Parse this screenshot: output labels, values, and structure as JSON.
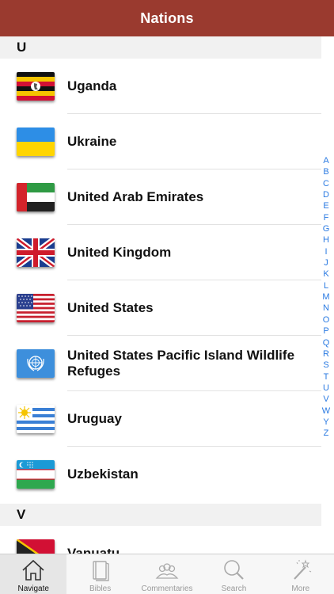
{
  "navbar": {
    "title": "Nations"
  },
  "sections": [
    {
      "letter": "U",
      "items": [
        {
          "name": "Uganda",
          "flag": "uganda-flag-icon"
        },
        {
          "name": "Ukraine",
          "flag": "ukraine-flag-icon"
        },
        {
          "name": "United Arab Emirates",
          "flag": "uae-flag-icon"
        },
        {
          "name": "United Kingdom",
          "flag": "uk-flag-icon"
        },
        {
          "name": "United States",
          "flag": "us-flag-icon"
        },
        {
          "name": "United States Pacific Island Wildlife Refuges",
          "flag": "un-flag-icon"
        },
        {
          "name": "Uruguay",
          "flag": "uruguay-flag-icon"
        },
        {
          "name": "Uzbekistan",
          "flag": "uzbekistan-flag-icon"
        }
      ]
    },
    {
      "letter": "V",
      "items": [
        {
          "name": "Vanuatu",
          "flag": "vanuatu-flag-icon"
        }
      ]
    }
  ],
  "index_letters": [
    "A",
    "B",
    "C",
    "D",
    "E",
    "F",
    "G",
    "H",
    "I",
    "J",
    "K",
    "L",
    "M",
    "N",
    "O",
    "P",
    "Q",
    "R",
    "S",
    "T",
    "U",
    "V",
    "W",
    "Y",
    "Z"
  ],
  "tabs": [
    {
      "label": "Navigate",
      "icon": "home-icon",
      "active": true
    },
    {
      "label": "Bibles",
      "icon": "books-icon",
      "active": false
    },
    {
      "label": "Commentaries",
      "icon": "people-icon",
      "active": false
    },
    {
      "label": "Search",
      "icon": "magnifier-icon",
      "active": false
    },
    {
      "label": "More",
      "icon": "magic-wand-icon",
      "active": false
    }
  ],
  "colors": {
    "navbar": "#9a3a2f",
    "index": "#2a7ae2",
    "section_bg": "#f1f1f1"
  }
}
